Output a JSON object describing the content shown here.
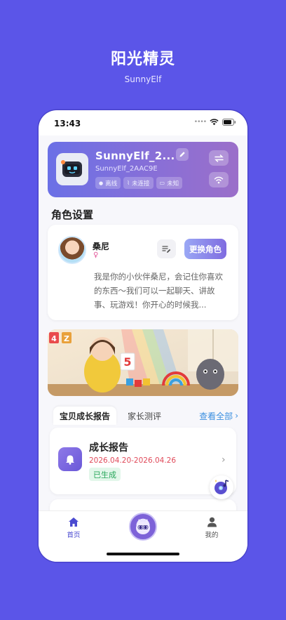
{
  "promo": {
    "title": "阳光精灵",
    "subtitle": "SunnyElf"
  },
  "status_bar": {
    "time": "13:43"
  },
  "device": {
    "name": "SunnyElf_2...",
    "id": "SunnyElf_2AAC9E",
    "chips": [
      {
        "label": "离线"
      },
      {
        "label": "未连接"
      },
      {
        "label": "未知"
      }
    ]
  },
  "role_section": {
    "title": "角色设置",
    "name": "桑尼",
    "gender_symbol": "♀",
    "change_label": "更换角色",
    "description": "我是你的小伙伴桑尼，会记住你喜欢的东西～我们可以一起聊天、讲故事、玩游戏！你开心的时候我..."
  },
  "banner": {
    "letters": [
      "4",
      "Z",
      "5"
    ]
  },
  "report_tabs": {
    "tabs": [
      {
        "label": "宝贝成长报告",
        "active": true
      },
      {
        "label": "家长测评",
        "active": false
      }
    ],
    "view_all": "查看全部"
  },
  "report_card": {
    "title": "成长报告",
    "date_range": "2026.04.20-2026.04.26",
    "badge": "已生成"
  },
  "tabbar": {
    "home": "首页",
    "mine": "我的"
  },
  "colors": {
    "background": "#5b55e8",
    "accent": "#7f6be0",
    "date_red": "#e04a5a",
    "badge_green": "#27a65a",
    "link_blue": "#3b8fe0"
  }
}
